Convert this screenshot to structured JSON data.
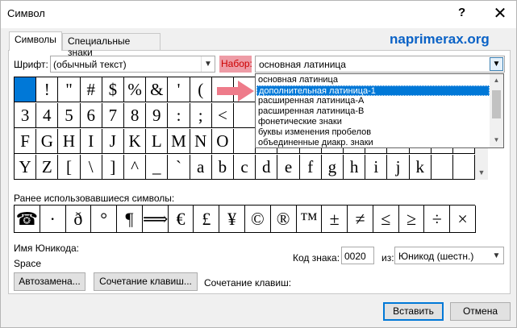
{
  "window": {
    "title": "Символ",
    "help": "?",
    "close": "✕"
  },
  "tabs": [
    {
      "label": "Символы"
    },
    {
      "label": "Специальные знаки"
    }
  ],
  "brand": "naprimerax.org",
  "font": {
    "label": "Шрифт:",
    "value": "(обычный текст)"
  },
  "subset": {
    "label": "Набор:",
    "value": "основная латиница",
    "options": [
      "основная латиница",
      "дополнительная латиница-1",
      "расширенная латиница-A",
      "расширенная латиница-B",
      "фонетические знаки",
      "буквы изменения пробелов",
      "объединенные диакр. знаки"
    ],
    "highlighted_index": 1
  },
  "grid": {
    "rows": [
      [
        " ",
        "!",
        "\"",
        "#",
        "$",
        "%",
        "&",
        "'",
        "(",
        "",
        "",
        "",
        "",
        "",
        "",
        "",
        "",
        "",
        "",
        "",
        ""
      ],
      [
        "3",
        "4",
        "5",
        "6",
        "7",
        "8",
        "9",
        ":",
        ";",
        "<",
        "",
        "",
        "",
        "",
        "",
        "",
        "",
        "",
        "",
        "",
        ""
      ],
      [
        "F",
        "G",
        "H",
        "I",
        "J",
        "K",
        "L",
        "M",
        "N",
        "O",
        "",
        "",
        "",
        "",
        "",
        "",
        "",
        "",
        "",
        "",
        ""
      ],
      [
        "Y",
        "Z",
        "[",
        "\\",
        "]",
        "^",
        "_",
        "`",
        "a",
        "b",
        "c",
        "d",
        "e",
        "f",
        "g",
        "h",
        "i",
        "j",
        "k",
        "",
        ""
      ]
    ],
    "selected": [
      0,
      0
    ]
  },
  "recent": {
    "label": "Ранее использовавшиеся символы:",
    "symbols": [
      "☎",
      "·",
      "ð",
      "°",
      "¶",
      "⟹",
      "€",
      "£",
      "¥",
      "©",
      "®",
      "™",
      "±",
      "≠",
      "≤",
      "≥",
      "÷",
      "×",
      "∞"
    ]
  },
  "unicode_name": {
    "label": "Имя Юникода:",
    "value": "Space"
  },
  "code": {
    "label": "Код знака:",
    "value": "0020"
  },
  "from": {
    "label": "из:",
    "value": "Юникод (шестн.)"
  },
  "buttons": {
    "autocorrect": "Автозамена...",
    "shortcut_key": "Сочетание клавиш...",
    "shortcut_label": "Сочетание клавиш:",
    "insert": "Вставить",
    "cancel": "Отмена"
  },
  "colors": {
    "selection": "#0078d7",
    "brand": "#0a62c6",
    "subset_highlight": "#ee9ca6",
    "arrow": "#ee7b8a"
  }
}
